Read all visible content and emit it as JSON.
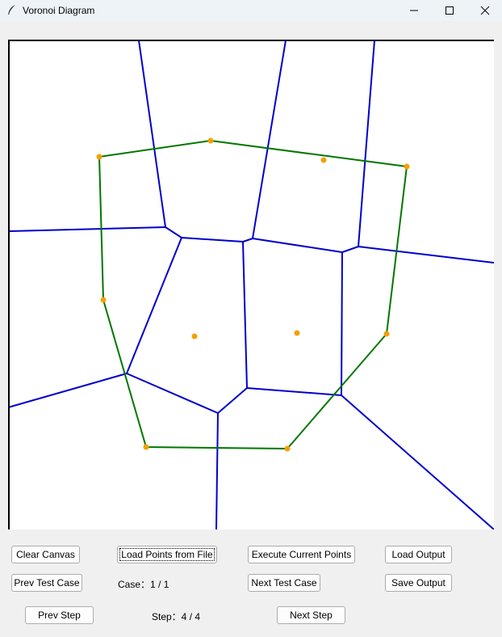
{
  "window": {
    "title": "Voronoi Diagram",
    "icon": "feather-icon"
  },
  "controls": {
    "clear_canvas": "Clear Canvas",
    "load_points": "Load Points from File",
    "execute_points": "Execute Current Points",
    "load_output": "Load Output",
    "prev_test_case": "Prev Test Case",
    "case_status": "Case：1 / 1",
    "next_test_case": "Next Test Case",
    "save_output": "Save Output",
    "prev_step": "Prev Step",
    "step_status": "Step：4 / 4",
    "next_step": "Next Step"
  },
  "diagram": {
    "colors": {
      "voronoi_edge": "#0000cc",
      "hull_edge": "#007700",
      "site": "#f5a000",
      "canvas": "#ffffff"
    }
  }
}
